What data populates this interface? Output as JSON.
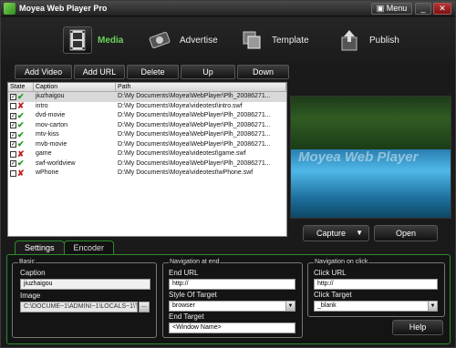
{
  "titlebar": {
    "title": "Moyea Web Player Pro",
    "menu_label": "Menu",
    "min_label": "_",
    "close_label": "✕"
  },
  "nav": {
    "items": [
      {
        "label": "Media",
        "icon": "film-icon"
      },
      {
        "label": "Advertise",
        "icon": "film-reel-icon"
      },
      {
        "label": "Template",
        "icon": "template-icon"
      },
      {
        "label": "Publish",
        "icon": "publish-icon"
      }
    ],
    "active": "Media"
  },
  "toolbar": {
    "add_video": "Add Video",
    "add_url": "Add URL",
    "delete": "Delete",
    "up": "Up",
    "down": "Down"
  },
  "list": {
    "columns": [
      "State",
      "Caption",
      "Path"
    ],
    "rows": [
      {
        "caption": "jiuzhaigou",
        "path": "D:\\My Documents\\Moyea\\WebPlayer\\Plh_20086271...",
        "status": "ok"
      },
      {
        "caption": "intro",
        "path": "D:\\My Documents\\Moyea\\videotest\\intro.swf",
        "status": "error"
      },
      {
        "caption": "dvd-movie",
        "path": "D:\\My Documents\\Moyea\\WebPlayer\\Plh_20086271...",
        "status": "ok"
      },
      {
        "caption": "mov-carton",
        "path": "D:\\My Documents\\Moyea\\WebPlayer\\Plh_20086271...",
        "status": "ok"
      },
      {
        "caption": "mtv-kiss",
        "path": "D:\\My Documents\\Moyea\\WebPlayer\\Plh_20086271...",
        "status": "ok"
      },
      {
        "caption": "mvb-movie",
        "path": "D:\\My Documents\\Moyea\\WebPlayer\\Plh_20086271...",
        "status": "ok"
      },
      {
        "caption": "game",
        "path": "D:\\My Documents\\Moyea\\videotest\\game.swf",
        "status": "error"
      },
      {
        "caption": "swf-worldview",
        "path": "D:\\My Documents\\Moyea\\WebPlayer\\Plh_20086271...",
        "status": "ok"
      },
      {
        "caption": "wPhone",
        "path": "D:\\My Documents\\Moyea\\videotest\\wPhone.swf",
        "status": "error"
      }
    ]
  },
  "preview": {
    "watermark": "Moyea Web Player"
  },
  "capture_label": "Capture",
  "open_label": "Open",
  "tabs": [
    "Settings",
    "Encoder"
  ],
  "basic": {
    "title": "Basic",
    "caption_label": "Caption",
    "caption_value": "jiuzhaigou",
    "image_label": "Image",
    "image_value": "C:\\DOCUME~1\\ADMINI~1\\LOCALS~1\\Temp\\mo..."
  },
  "nav_end": {
    "title": "Navigation at end",
    "end_url_label": "End URL",
    "end_url_value": "http://",
    "style_label": "Style Of Target",
    "style_value": "browser",
    "target_label": "End Target",
    "target_value": "<Window Name>"
  },
  "nav_click": {
    "title": "Navigation on click",
    "click_url_label": "Click URL",
    "click_url_value": "http://",
    "click_target_label": "Click Target",
    "click_target_value": "_blank"
  },
  "help_label": "Help"
}
